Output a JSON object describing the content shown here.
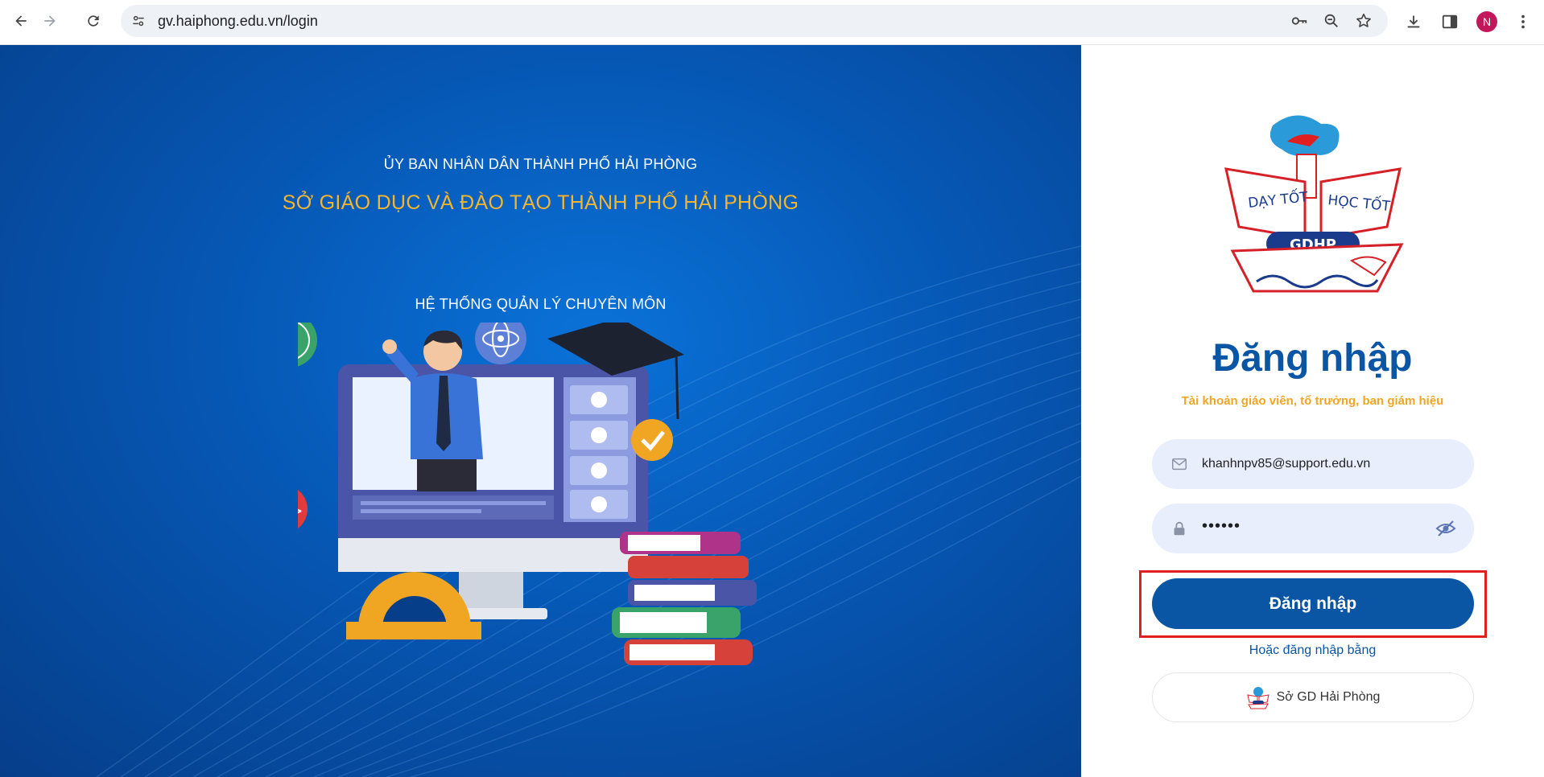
{
  "browser": {
    "url": "gv.haiphong.edu.vn/login",
    "profile_initial": "N",
    "profile_color": "#c2185b"
  },
  "hero": {
    "line1": "ỦY BAN NHÂN DÂN THÀNH PHỐ HẢI PHÒNG",
    "line2": "SỞ GIÁO DỤC VÀ ĐÀO TẠO THÀNH PHỐ HẢI PHÒNG",
    "line3": "HỆ THỐNG QUẢN LÝ CHUYÊN MÔN",
    "background_color": "#0657b4",
    "accent_color": "#f5b52c"
  },
  "logo": {
    "text_left": "DẠY TỐT",
    "text_right": "HỌC TỐT",
    "badge": "GDHP"
  },
  "login": {
    "title": "Đăng nhập",
    "subtitle": "Tài khoản giáo viên, tổ trưởng, ban giám hiệu",
    "email_value": "khanhnpv85@support.edu.vn",
    "password_value": "••••••",
    "submit_label": "Đăng nhập",
    "alt_text": "Hoặc đăng nhập bằng",
    "sso_label": "Sở GD Hải Phòng",
    "primary_color": "#0b56a4",
    "highlight_color": "#e02020"
  },
  "icons": {
    "back": "arrow-left-icon",
    "forward": "arrow-right-icon",
    "reload": "reload-icon",
    "site_settings": "tune-icon",
    "password_key": "key-icon",
    "zoom": "zoom-icon",
    "bookmark": "star-icon",
    "downloads": "download-icon",
    "side_panel": "side-panel-icon",
    "menu": "more-vert-icon",
    "email": "mail-icon",
    "password": "lock-icon",
    "toggle_password": "eye-off-icon"
  }
}
